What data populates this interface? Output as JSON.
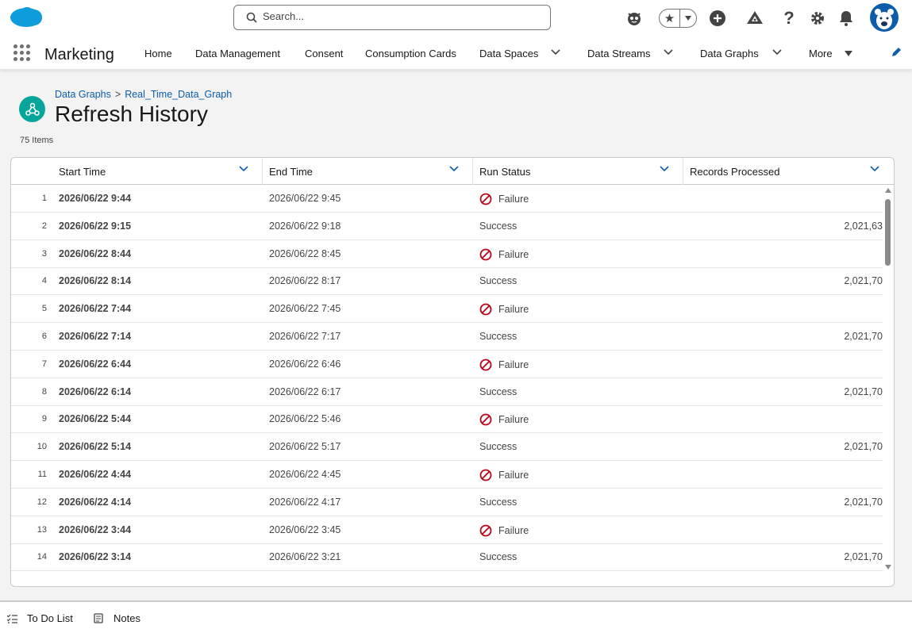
{
  "search": {
    "placeholder": "Search..."
  },
  "app": {
    "name": "Marketing"
  },
  "nav": {
    "items": [
      {
        "label": "Home"
      },
      {
        "label": "Data Management"
      },
      {
        "label": "Consent"
      },
      {
        "label": "Consumption Cards"
      },
      {
        "label": "Data Spaces"
      },
      {
        "label": "Data Streams"
      },
      {
        "label": "Data Graphs"
      },
      {
        "label": "More"
      }
    ]
  },
  "breadcrumb": {
    "parent": "Data Graphs",
    "separator": ">",
    "current": "Real_Time_Data_Graph"
  },
  "page": {
    "title": "Refresh History",
    "count": "75 Items"
  },
  "table": {
    "columns": [
      "Start Time",
      "End Time",
      "Run Status",
      "Records Processed"
    ],
    "rows": [
      {
        "n": "1",
        "start": "2026/06/22 9:44",
        "end": "2026/06/22 9:45",
        "status": "Failure",
        "records": ""
      },
      {
        "n": "2",
        "start": "2026/06/22 9:15",
        "end": "2026/06/22 9:18",
        "status": "Success",
        "records": "2,021,63"
      },
      {
        "n": "3",
        "start": "2026/06/22 8:44",
        "end": "2026/06/22 8:45",
        "status": "Failure",
        "records": ""
      },
      {
        "n": "4",
        "start": "2026/06/22 8:14",
        "end": "2026/06/22 8:17",
        "status": "Success",
        "records": "2,021,70"
      },
      {
        "n": "5",
        "start": "2026/06/22 7:44",
        "end": "2026/06/22 7:45",
        "status": "Failure",
        "records": ""
      },
      {
        "n": "6",
        "start": "2026/06/22 7:14",
        "end": "2026/06/22 7:17",
        "status": "Success",
        "records": "2,021,70"
      },
      {
        "n": "7",
        "start": "2026/06/22 6:44",
        "end": "2026/06/22 6:46",
        "status": "Failure",
        "records": ""
      },
      {
        "n": "8",
        "start": "2026/06/22 6:14",
        "end": "2026/06/22 6:17",
        "status": "Success",
        "records": "2,021,70"
      },
      {
        "n": "9",
        "start": "2026/06/22 5:44",
        "end": "2026/06/22 5:46",
        "status": "Failure",
        "records": ""
      },
      {
        "n": "10",
        "start": "2026/06/22 5:14",
        "end": "2026/06/22 5:17",
        "status": "Success",
        "records": "2,021,70"
      },
      {
        "n": "11",
        "start": "2026/06/22 4:44",
        "end": "2026/06/22 4:45",
        "status": "Failure",
        "records": ""
      },
      {
        "n": "12",
        "start": "2026/06/22 4:14",
        "end": "2026/06/22 4:17",
        "status": "Success",
        "records": "2,021,70"
      },
      {
        "n": "13",
        "start": "2026/06/22 3:44",
        "end": "2026/06/22 3:45",
        "status": "Failure",
        "records": ""
      },
      {
        "n": "14",
        "start": "2026/06/22 3:14",
        "end": "2026/06/22 3:21",
        "status": "Success",
        "records": "2,021,70"
      }
    ]
  },
  "footer": {
    "todo": "To Do List",
    "notes": "Notes"
  },
  "colors": {
    "brand": "#0b5cab",
    "failure": "#ba0517",
    "graph_icon": "#06a59a"
  }
}
